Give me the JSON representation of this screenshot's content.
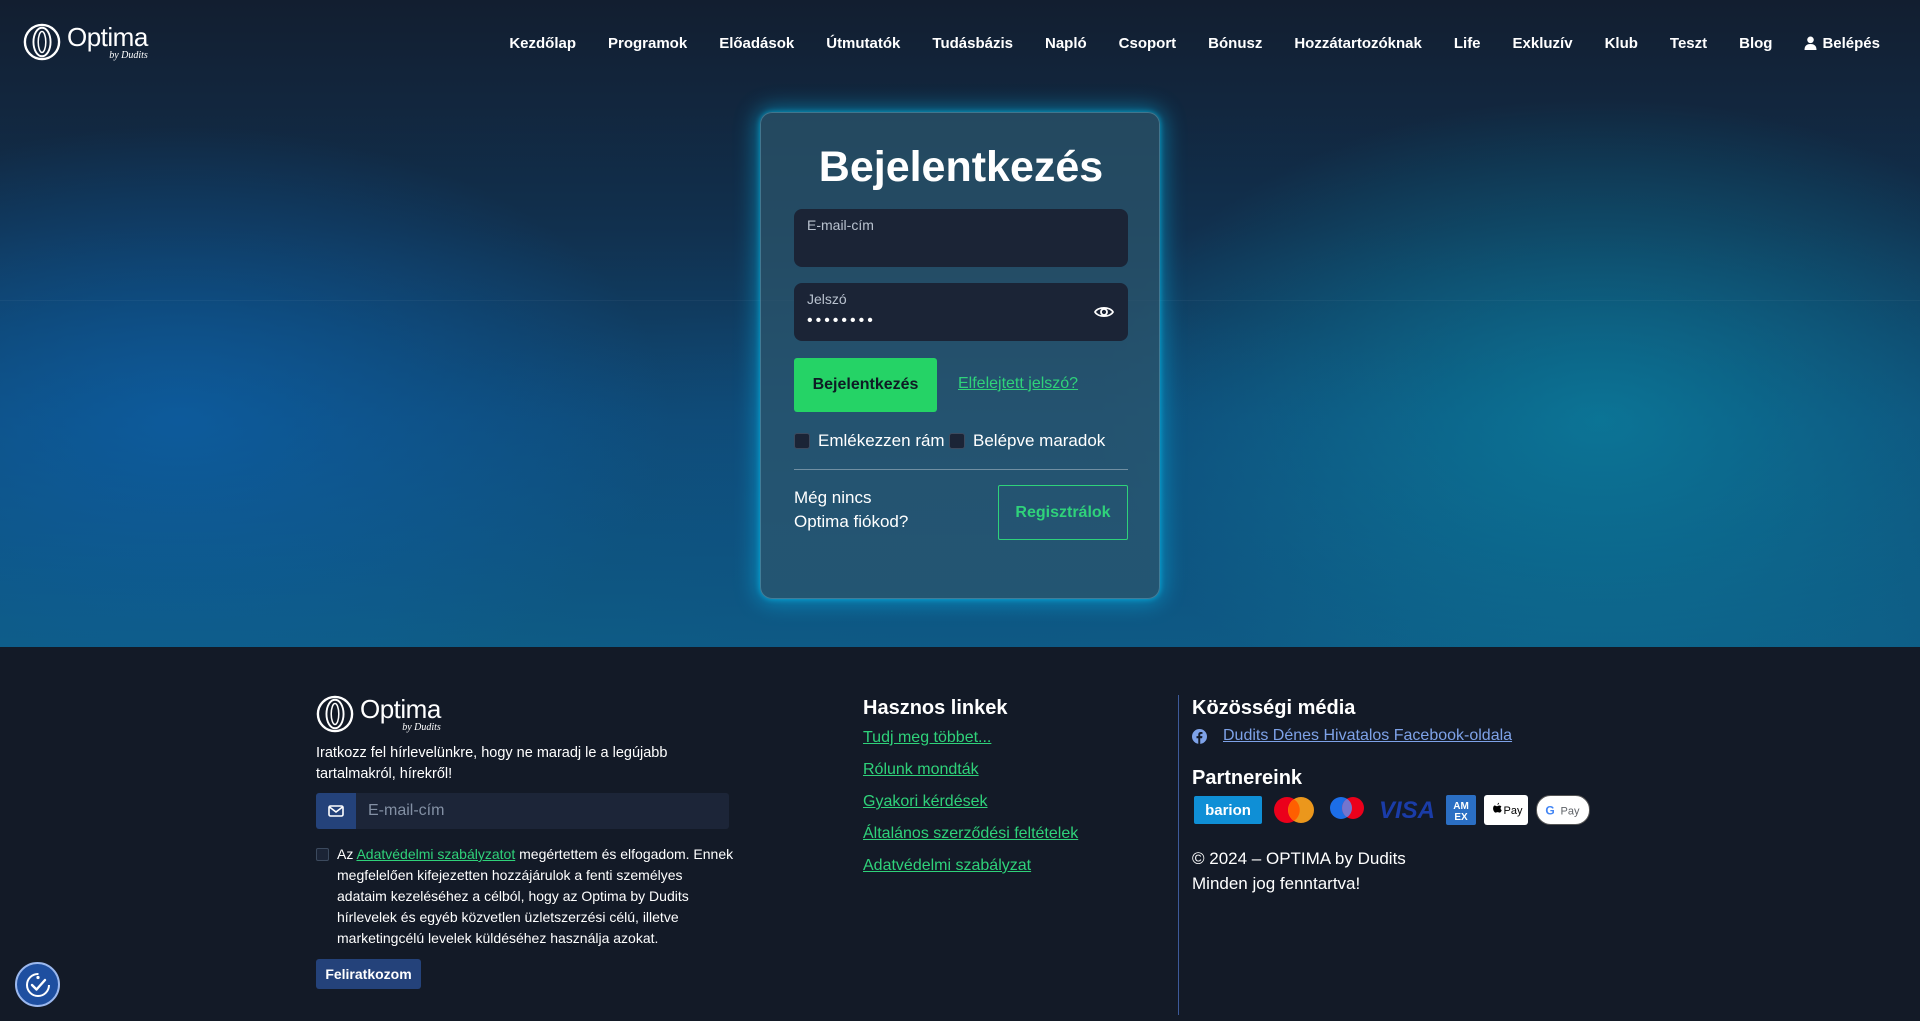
{
  "brand": {
    "name": "Optima",
    "byline": "by Dudits"
  },
  "nav": {
    "items": [
      "Kezdőlap",
      "Programok",
      "Előadások",
      "Útmutatók",
      "Tudásbázis",
      "Napló",
      "Csoport",
      "Bónusz",
      "Hozzátartozóknak",
      "Life",
      "Exkluzív",
      "Klub",
      "Teszt",
      "Blog"
    ],
    "login_label": "Belépés"
  },
  "login": {
    "title": "Bejelentkezés",
    "email_label": "E-mail-cím",
    "email_value": "",
    "password_label": "Jelszó",
    "password_value": "••••••••",
    "submit_label": "Bejelentkezés",
    "forgot_label": "Elfelejtett jelszó?",
    "remember_label": "Emlékezzen rám",
    "stay_label": "Belépve maradok",
    "no_account_text": "Még nincs Optima fiókod?",
    "register_label": "Regisztrálok"
  },
  "footer": {
    "newsletter_text": "Iratkozz fel hírlevelünkre, hogy ne maradj le a legújabb tartalmakról, hírekről!",
    "newsletter_placeholder": "E-mail-cím",
    "consent_prefix": "Az ",
    "consent_link": "Adatvédelmi szabályzatot",
    "consent_rest": " megértettem és elfogadom. Ennek megfelelően kifejezetten hozzájárulok a fenti személyes adataim kezeléséhez a célból, hogy az Optima by Dudits hírlevelek és egyéb közvetlen üzletszerzési célú, illetve marketingcélú levelek küldéséhez használja azokat.",
    "subscribe_label": "Feliratkozom",
    "useful_links_title": "Hasznos linkek",
    "useful_links": [
      "Tudj meg többet...",
      "Rólunk mondták",
      "Gyakori kérdések",
      "Általános szerződési feltételek",
      "Adatvédelmi szabályzat"
    ],
    "social_title": "Közösségi média",
    "facebook_label": "Dudits Dénes Hivatalos Facebook-oldala",
    "partners_title": "Partnereink",
    "partners": [
      "barion",
      "Mastercard",
      "Maestro",
      "VISA",
      "American Express",
      "Apple Pay",
      "Google Pay"
    ],
    "copyright_line1": "© 2024 – OPTIMA by Dudits",
    "copyright_line2": "Minden jog fenntartva!"
  },
  "colors": {
    "accent": "#25d366",
    "link": "#2fd27a",
    "footer_bg": "#131a27",
    "navy_button": "#24427a"
  }
}
